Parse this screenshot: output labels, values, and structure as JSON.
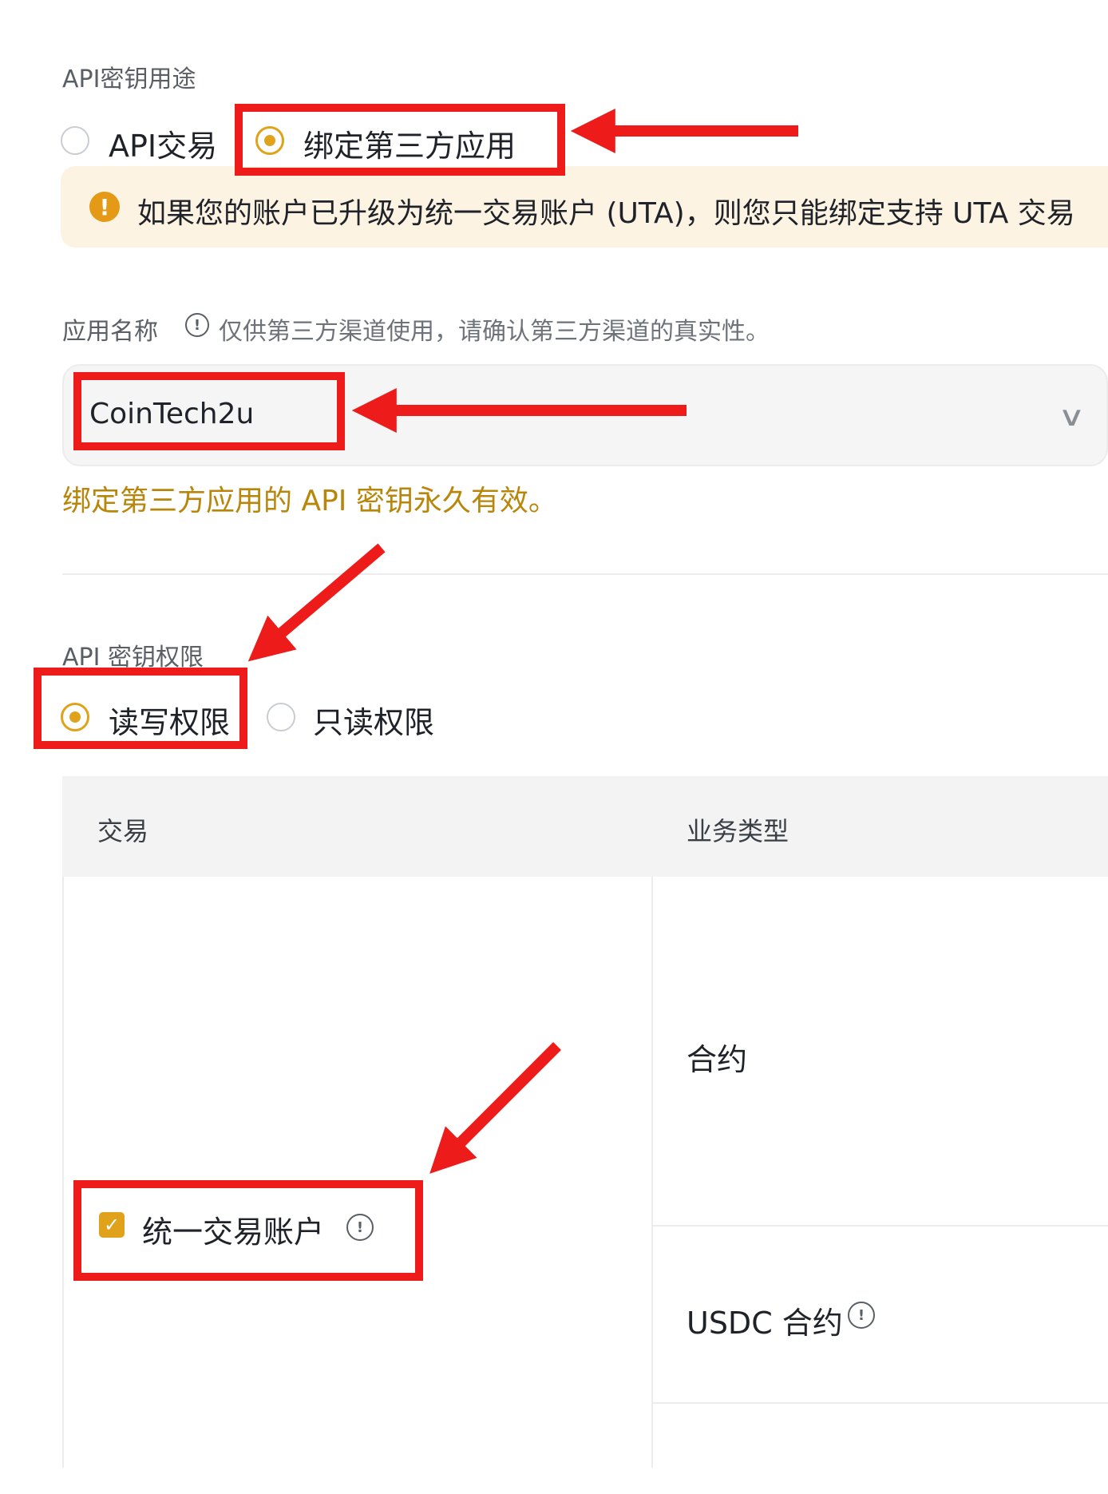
{
  "purpose": {
    "label": "API密钥用途",
    "options": [
      {
        "label": "API交易",
        "checked": false
      },
      {
        "label": "绑定第三方应用",
        "checked": true
      }
    ]
  },
  "notice": {
    "icon": "warning-icon",
    "text": "如果您的账户已升级为统一交易账户 (UTA)，则您只能绑定支持 UTA 交易"
  },
  "app_name": {
    "label": "应用名称",
    "hint": "仅供第三方渠道使用，请确认第三方渠道的真实性。",
    "value": "CoinTech2u",
    "validity_note": "绑定第三方应用的 API 密钥永久有效。"
  },
  "permissions": {
    "label": "API 密钥权限",
    "options": [
      {
        "label": "读写权限",
        "checked": true
      },
      {
        "label": "只读权限",
        "checked": false
      }
    ]
  },
  "table": {
    "headers": [
      "交易",
      "业务类型"
    ],
    "account_checkbox": {
      "label": "统一交易账户",
      "checked": true
    },
    "business_types": [
      "合约",
      "USDC 合约"
    ]
  },
  "colors": {
    "accent": "#e0a21b",
    "annotation": "#ee1b1b",
    "notice_bg": "#fdf3e3",
    "gold_text": "#b8860b"
  }
}
